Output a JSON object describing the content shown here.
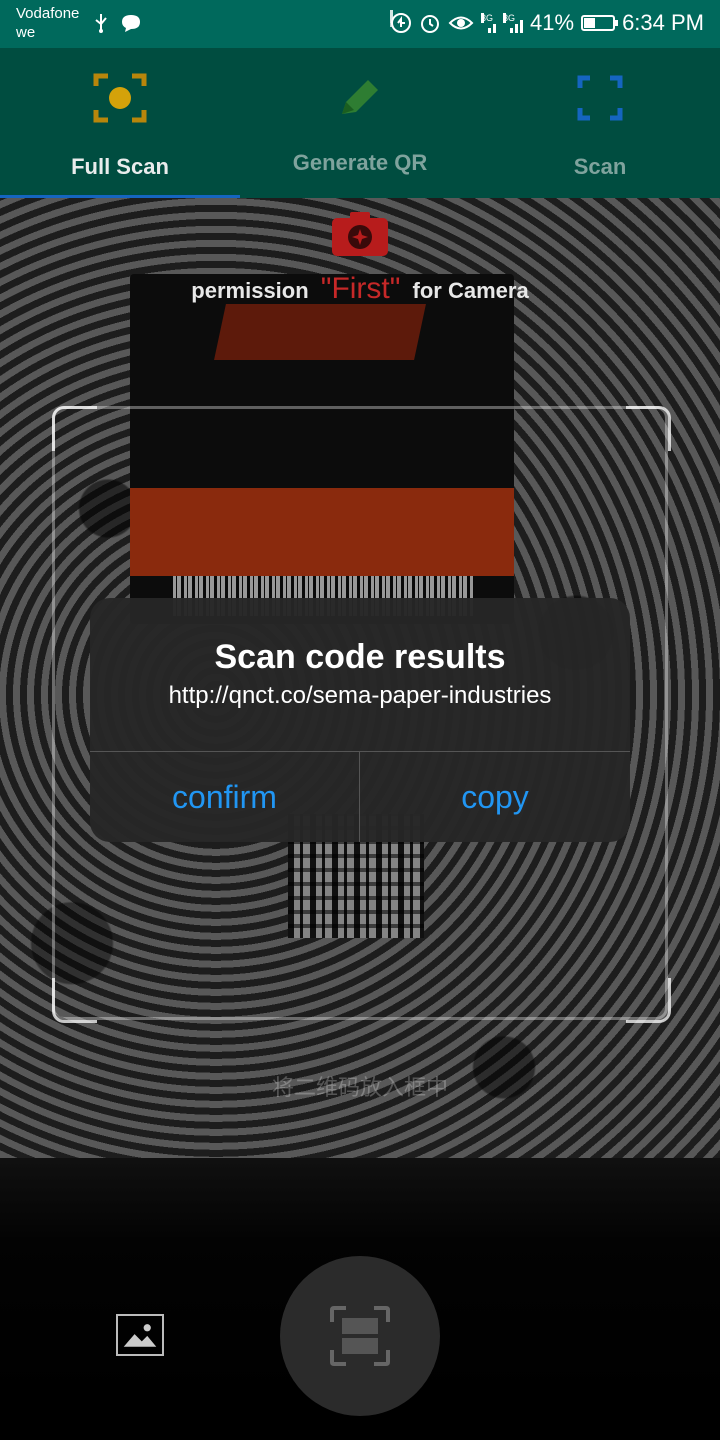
{
  "status_bar": {
    "carrier_line1": "Vodafone",
    "carrier_line2": "we",
    "left_icons": [
      "usb-icon",
      "chat-icon"
    ],
    "right_icons": [
      "data-saver-icon",
      "alarm-icon",
      "eye-comfort-icon",
      "signal-3g-icon",
      "signal-3g-icon-2",
      "battery-icon"
    ],
    "network_label_1": "3G",
    "network_label_2": "3G",
    "battery_percent": "41%",
    "battery_level": 0.41,
    "time": "6:34 PM"
  },
  "tabs": [
    {
      "label": "Full Scan",
      "icon": "focus-camera-icon",
      "selected": true
    },
    {
      "label": "Generate QR",
      "icon": "pencil-icon",
      "selected": false
    },
    {
      "label": "Scan",
      "icon": "scan-frame-icon",
      "selected": false
    }
  ],
  "camera": {
    "permission_prefix": "permission",
    "permission_highlight": "\"First\"",
    "permission_suffix": "for Camera",
    "hint_text": "将二维码放入框中"
  },
  "dialog": {
    "title": "Scan code results",
    "message": "http://qnct.co/sema-paper-industries",
    "confirm_label": "confirm",
    "copy_label": "copy"
  },
  "controls": {
    "gallery_icon": "gallery-icon",
    "shutter_icon": "scan-shutter-icon"
  },
  "colors": {
    "status_bar": "#00695c",
    "tab_bar": "#004d40",
    "tab_indicator": "#1565c0",
    "accent_button": "#2196f3",
    "highlight_red": "#c62828"
  }
}
